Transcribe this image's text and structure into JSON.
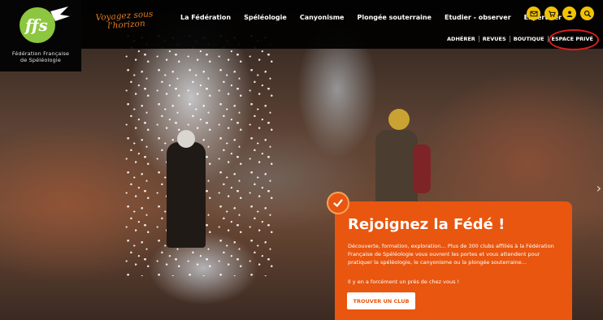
{
  "brand": {
    "org_name_line1": "Fédération Française",
    "org_name_line2": "de Spéléologie",
    "tagline_line1": "Voyagez sous",
    "tagline_line2": "l'horizon",
    "logo_color": "#8dc63f"
  },
  "nav": {
    "items": [
      {
        "label": "La Fédération"
      },
      {
        "label": "Spéléologie"
      },
      {
        "label": "Canyonisme"
      },
      {
        "label": "Plongée souterraine"
      },
      {
        "label": "Etudier - observer"
      },
      {
        "label": "Expertiser"
      }
    ]
  },
  "icons": [
    {
      "name": "mail-icon"
    },
    {
      "name": "cart-icon"
    },
    {
      "name": "user-icon"
    },
    {
      "name": "search-icon"
    }
  ],
  "subnav": {
    "items": [
      {
        "label": "ADHÉRER"
      },
      {
        "label": "REVUES"
      },
      {
        "label": "BOUTIQUE"
      },
      {
        "label": "ESPACE PRIVÉ"
      }
    ]
  },
  "join": {
    "title": "Rejoignez la Fédé !",
    "text": "Découverte, formation, exploration… Plus de 300 clubs affiliés à la Fédération Française de Spéléologie vous ouvrent les portes et vous attendent pour pratiquer la spéléologie, le canyonisme ou la plongée souterraine…",
    "text2": "Il y en a forcément un près de chez vous !",
    "button_label": "TROUVER UN CLUB"
  },
  "colors": {
    "accent_orange": "#e8560f",
    "icon_yellow": "#f2c200",
    "highlight_red": "#d81f1f",
    "tagline_orange": "#e07a1f"
  }
}
